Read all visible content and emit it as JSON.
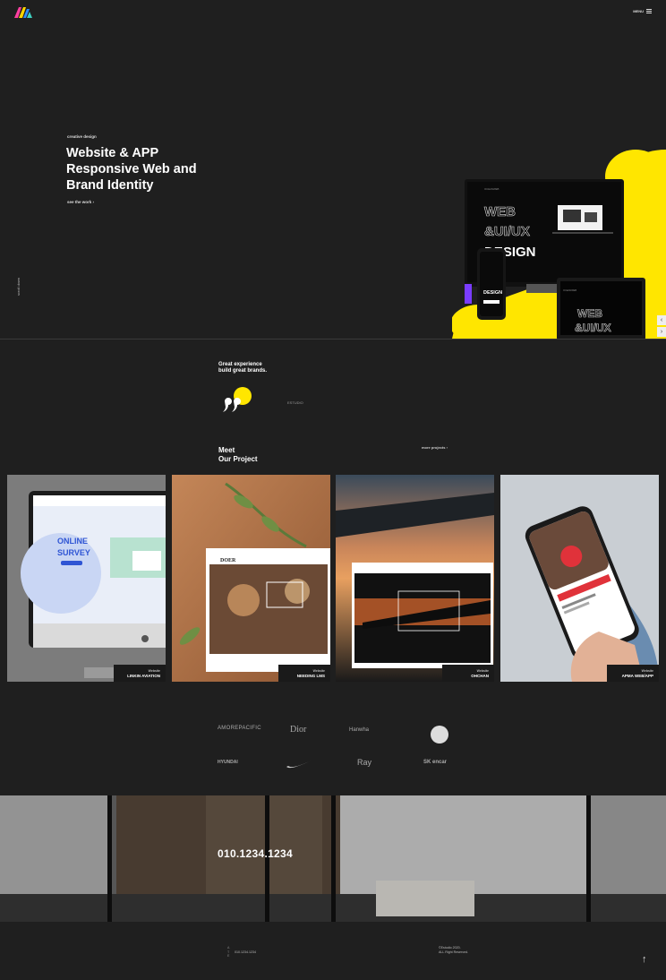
{
  "header": {
    "nav_label": "",
    "menu_label": "MENU"
  },
  "hero": {
    "eyebrow": "creative design",
    "title_lines": [
      "Website & APP",
      "Responsive Web and",
      "Brand Identity"
    ],
    "see_work": "see the work",
    "scroll_label": "scroll down",
    "mock_brand": "OCEANWEB",
    "mock_headline_lines": [
      "WEB",
      "&UI/UX",
      "DESIGN"
    ],
    "mock_small_lines": [
      "WEB",
      "&UI/UX"
    ],
    "mock_tag": "DESIGN"
  },
  "intro": {
    "heading_lines": [
      "Great experience",
      "build great brands."
    ],
    "body": "",
    "sub": "ESTUDIO"
  },
  "projects": {
    "heading_lines": [
      "Meet",
      "Our Project"
    ],
    "more_label": "more projects",
    "items": [
      {
        "category": "Website",
        "title": "LINKIN AVIATION",
        "art_text": [
          "ONLINE",
          "SURVEY"
        ]
      },
      {
        "category": "Website",
        "title": "NEEDING LMS",
        "art_text": [
          "DOER"
        ]
      },
      {
        "category": "Website",
        "title": "OHCHAN",
        "art_text": []
      },
      {
        "category": "Website",
        "title": "APMA WEB/APP",
        "art_text": []
      }
    ]
  },
  "clients": {
    "label": "",
    "brands": [
      "AMOREPACIFIC",
      "Dior",
      "Hanwha",
      "",
      "HYUNDAI",
      "",
      "Ray",
      "SK encar"
    ]
  },
  "contact": {
    "label": "",
    "phone": "010.1234.1234",
    "description": ""
  },
  "footer": {
    "col1_lines": [
      "",
      "",
      ""
    ],
    "col2_items": [
      {
        "key": "A",
        "value": ""
      },
      {
        "key": "T",
        "value": "010.1234.1234"
      },
      {
        "key": "E",
        "value": ""
      }
    ],
    "col3_lines": [
      "©Estudio 2020.",
      "ALL Right Reserved."
    ]
  },
  "colors": {
    "background": "#1f1f1f",
    "accent_yellow": "#ffe600",
    "accent_purple": "#7a3cff"
  },
  "icons": [
    "logo-icon",
    "menu-icon",
    "arrow-right-icon",
    "quote-icon",
    "arrow-up-icon"
  ]
}
